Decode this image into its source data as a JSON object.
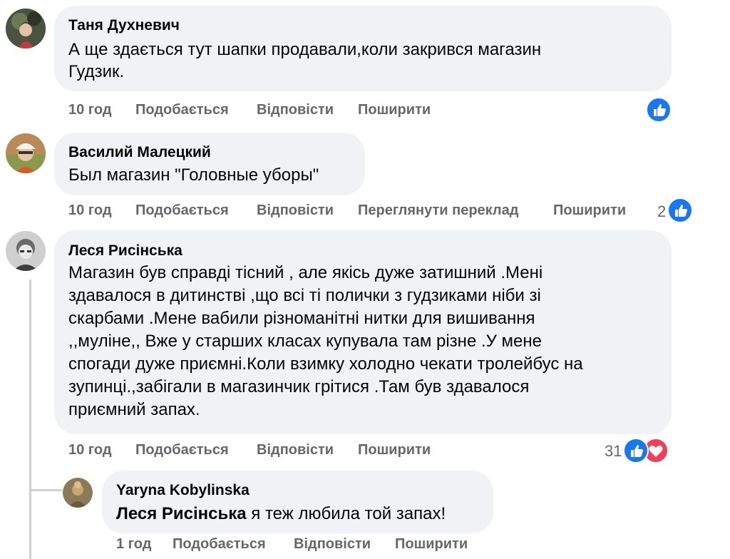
{
  "comments": [
    {
      "author": "Таня Духневич",
      "lines": [
        "А ще здається тут шапки продавали,коли закрився магазин",
        "Гудзик."
      ],
      "time": "10 год",
      "like": "Подобається",
      "reply": "Відповісти",
      "share": "Поширити",
      "reactions_count": ""
    },
    {
      "author": "Василий Малецкий",
      "lines": [
        "Был магазин \"Головные уборы\""
      ],
      "time": "10 год",
      "like": "Подобається",
      "reply": "Відповісти",
      "translate": "Переглянути переклад",
      "share": "Поширити",
      "reactions_count": "2"
    },
    {
      "author": "Леся Рисінська",
      "lines": [
        "Магазин був справді тісний , але якісь дуже затишний .Мені",
        "здавалося в дитинстві ,що всі ті полички з гудзиками ніби зі",
        "скарбами .Мене вабили різноманітні нитки для вишивання",
        ",,муліне,, Вже у старших класах купувала там різне .У мене",
        "спогади дуже приємні.Коли взимку холодно чекати тролейбус на",
        "зупинці.,забігали в магазинчик грітися .Там був здавалося",
        "приємний запах."
      ],
      "time": "10 год",
      "like": "Подобається",
      "reply": "Відповісти",
      "share": "Поширити",
      "reactions_count": "31"
    }
  ],
  "reply": {
    "author": "Yaryna Kobylinska",
    "mention": "Леся Рисінська",
    "text": " я теж любила той запах!",
    "time": "1 год",
    "like": "Подобається",
    "reply": "Відповісти",
    "share": "Поширити"
  },
  "colors": {
    "like": "#1877f2",
    "love": "#f33e58",
    "bubble": "#f0f2f5",
    "meta": "#65676b"
  }
}
